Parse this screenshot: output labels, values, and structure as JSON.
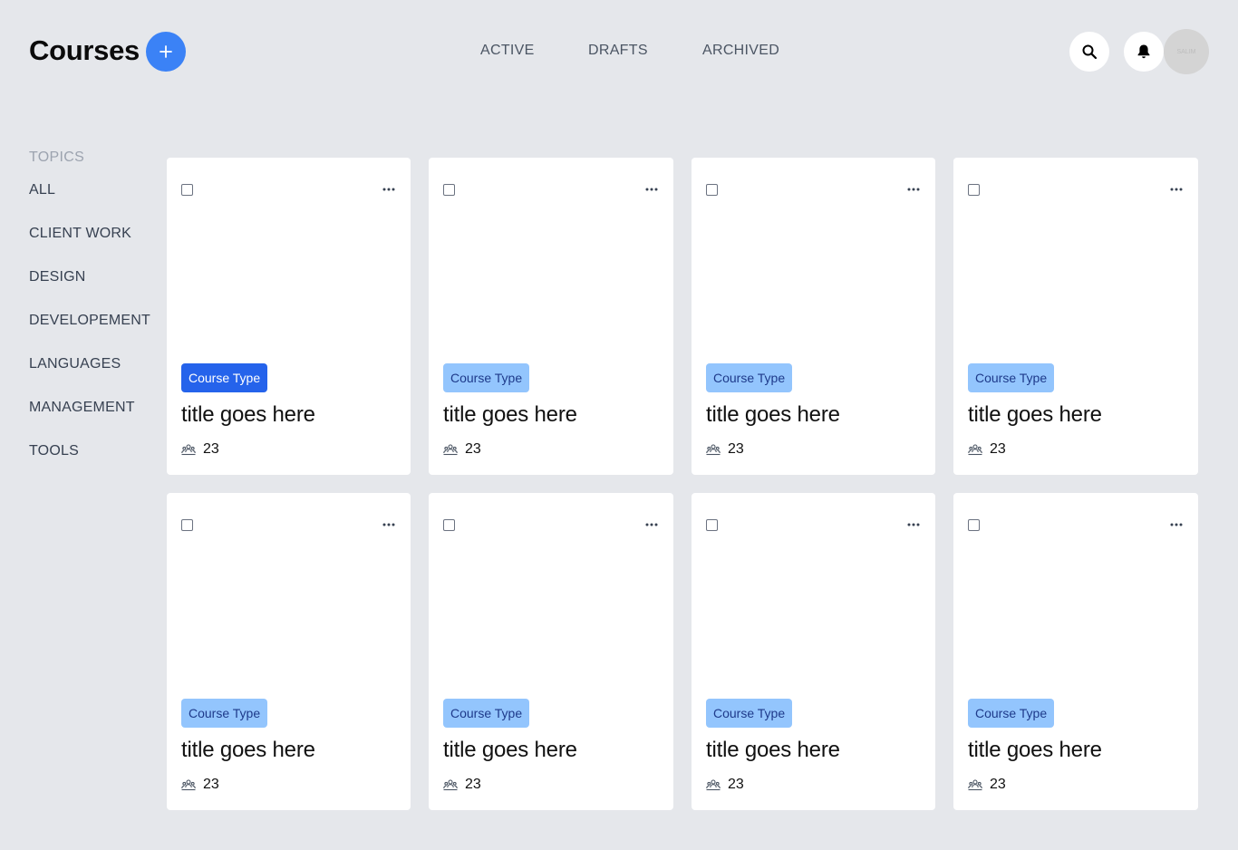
{
  "header": {
    "title": "Courses",
    "add_icon": "plus-icon",
    "tabs": [
      {
        "label": "ACTIVE"
      },
      {
        "label": "DRAFTS"
      },
      {
        "label": "ARCHIVED"
      }
    ],
    "search_icon": "search-icon",
    "bell_icon": "bell-icon",
    "avatar_text": "SALIM"
  },
  "sidebar": {
    "heading": "TOPICS",
    "items": [
      {
        "label": "ALL"
      },
      {
        "label": "CLIENT WORK"
      },
      {
        "label": "DESIGN"
      },
      {
        "label": "DEVELOPEMENT"
      },
      {
        "label": "LANGUAGES"
      },
      {
        "label": "MANAGEMENT"
      },
      {
        "label": "TOOLS"
      }
    ]
  },
  "colors": {
    "accent": "#3b82f6",
    "badge_primary": "#2563eb",
    "badge_light": "#93c5fd",
    "background": "#e5e7eb"
  },
  "cards": [
    {
      "badge": "Course Type",
      "title": "title goes here",
      "count": "23",
      "highlighted": true
    },
    {
      "badge": "Course Type",
      "title": "title goes here",
      "count": "23",
      "highlighted": false
    },
    {
      "badge": "Course Type",
      "title": "title goes here",
      "count": "23",
      "highlighted": false
    },
    {
      "badge": "Course Type",
      "title": "title goes here",
      "count": "23",
      "highlighted": false
    },
    {
      "badge": "Course Type",
      "title": "title goes here",
      "count": "23",
      "highlighted": false
    },
    {
      "badge": "Course Type",
      "title": "title goes here",
      "count": "23",
      "highlighted": false
    },
    {
      "badge": "Course Type",
      "title": "title goes here",
      "count": "23",
      "highlighted": false
    },
    {
      "badge": "Course Type",
      "title": "title goes here",
      "count": "23",
      "highlighted": false
    }
  ]
}
